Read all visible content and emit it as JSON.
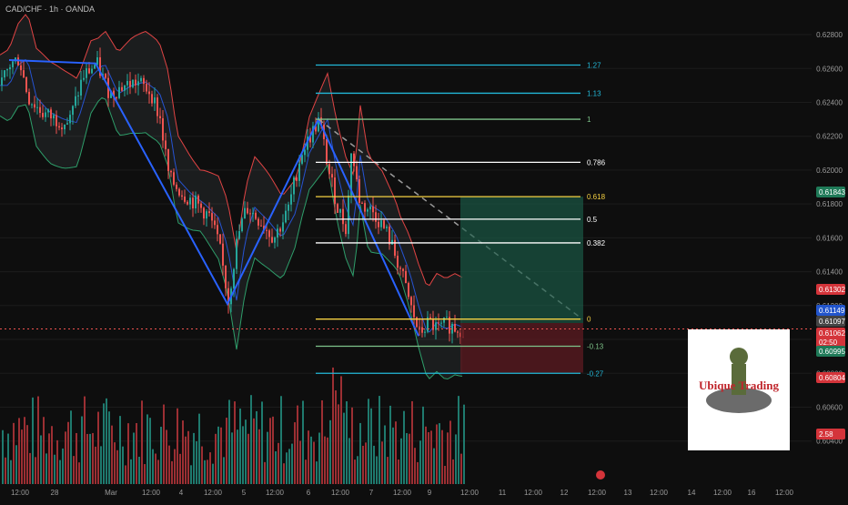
{
  "header": {
    "title": "CAD/CHF · 1h · OANDA"
  },
  "colors": {
    "background": "#0e0e0e",
    "bull": "#26a69a",
    "bear": "#ef5350",
    "upper_band": "#e04444",
    "lower_band": "#2e9e6a",
    "basis": "#2962ff",
    "zigzag": "#2962ff",
    "fib_127": "#22b8d8",
    "fib_113": "#22b8d8",
    "fib_1": "#7ec48a",
    "fib_0786": "#ffffff",
    "fib_0618": "#f5d142",
    "fib_05": "#ffffff",
    "fib_0382": "#ffffff",
    "fib_0": "#f5d142",
    "fib_m013": "#7ec48a",
    "fib_m027": "#22b8d8",
    "profit_zone": "#1b5e4a",
    "loss_zone": "#5e1b22"
  },
  "chart_data": {
    "type": "candlestick",
    "symbol": "CAD/CHF",
    "timeframe": "1h",
    "broker": "OANDA",
    "ylim": [
      0.6035,
      0.6287
    ],
    "y_ticks": [
      "0.62800",
      "0.62600",
      "0.62400",
      "0.62200",
      "0.62000",
      "0.61800",
      "0.61600",
      "0.61400",
      "0.61200",
      "0.61000",
      "0.60800",
      "0.60600",
      "0.60400"
    ],
    "x_ticks": [
      "12:00",
      "28",
      "Mar",
      "12:00",
      "4",
      "12:00",
      "5",
      "12:00",
      "6",
      "12:00",
      "7",
      "12:00",
      "9",
      "12:00",
      "11",
      "12:00",
      "12",
      "12:00",
      "13",
      "12:00",
      "14",
      "12:00",
      "16",
      "12:00"
    ],
    "price_path": [
      [
        0,
        0.625
      ],
      [
        10,
        0.6262
      ],
      [
        20,
        0.6266
      ],
      [
        30,
        0.6243
      ],
      [
        45,
        0.6234
      ],
      [
        60,
        0.623
      ],
      [
        75,
        0.6228
      ],
      [
        90,
        0.6255
      ],
      [
        105,
        0.6263
      ],
      [
        120,
        0.6245
      ],
      [
        135,
        0.625
      ],
      [
        150,
        0.6252
      ],
      [
        165,
        0.6246
      ],
      [
        175,
        0.623
      ],
      [
        185,
        0.6195
      ],
      [
        200,
        0.6186
      ],
      [
        215,
        0.618
      ],
      [
        230,
        0.6172
      ],
      [
        240,
        0.6155
      ],
      [
        250,
        0.6123
      ],
      [
        260,
        0.616
      ],
      [
        270,
        0.6178
      ],
      [
        285,
        0.617
      ],
      [
        300,
        0.616
      ],
      [
        315,
        0.6175
      ],
      [
        330,
        0.621
      ],
      [
        350,
        0.623
      ],
      [
        360,
        0.62
      ],
      [
        370,
        0.6178
      ],
      [
        380,
        0.6165
      ],
      [
        385,
        0.6212
      ],
      [
        395,
        0.618
      ],
      [
        410,
        0.6175
      ],
      [
        425,
        0.6162
      ],
      [
        440,
        0.614
      ],
      [
        450,
        0.612
      ],
      [
        460,
        0.6103
      ],
      [
        470,
        0.611
      ],
      [
        480,
        0.6106
      ],
      [
        490,
        0.6109
      ],
      [
        500,
        0.6107
      ],
      [
        508,
        0.6106
      ]
    ],
    "bollinger": {
      "upper_at_peak": 0.6245,
      "lower_at_low": 0.612
    },
    "zigzag_points": [
      [
        "Feb 28 early",
        0.6265
      ],
      [
        "Mar 4 late",
        0.612
      ],
      [
        "Mar 6",
        0.623
      ],
      [
        "Mar 9",
        0.6101
      ]
    ],
    "fibonacci": [
      {
        "label": "1.27",
        "price": 0.6262
      },
      {
        "label": "1.13",
        "price": 0.62454
      },
      {
        "label": "1",
        "price": 0.623
      },
      {
        "label": "0.786",
        "price": 0.62046
      },
      {
        "label": "0.618",
        "price": 0.61843
      },
      {
        "label": "0.5",
        "price": 0.6171
      },
      {
        "label": "0.382",
        "price": 0.6157
      },
      {
        "label": "0",
        "price": 0.6112
      },
      {
        "label": "-0.13",
        "price": 0.6096
      },
      {
        "label": "-0.27",
        "price": 0.608
      }
    ],
    "position": {
      "type": "long",
      "entry": 0.61097,
      "target": 0.61843,
      "stop": 0.60804
    },
    "price_tags": [
      {
        "value": "0.61843",
        "color": "#1f7a58"
      },
      {
        "value": "0.61302",
        "color": "#d4343a"
      },
      {
        "value": "0.61149",
        "color": "#2255cc"
      },
      {
        "value": "0.61097",
        "color": "#444444"
      },
      {
        "value": "0.61062",
        "sub": "02:50",
        "color": "#d4343a"
      },
      {
        "value": "0.60995",
        "color": "#1f7a58"
      },
      {
        "value": "0.60804",
        "color": "#d4343a"
      },
      {
        "value": "2.58",
        "color": "#d4343a"
      }
    ],
    "volume_note": "volume histogram along bottom",
    "watermark": "Ubique Trading"
  }
}
